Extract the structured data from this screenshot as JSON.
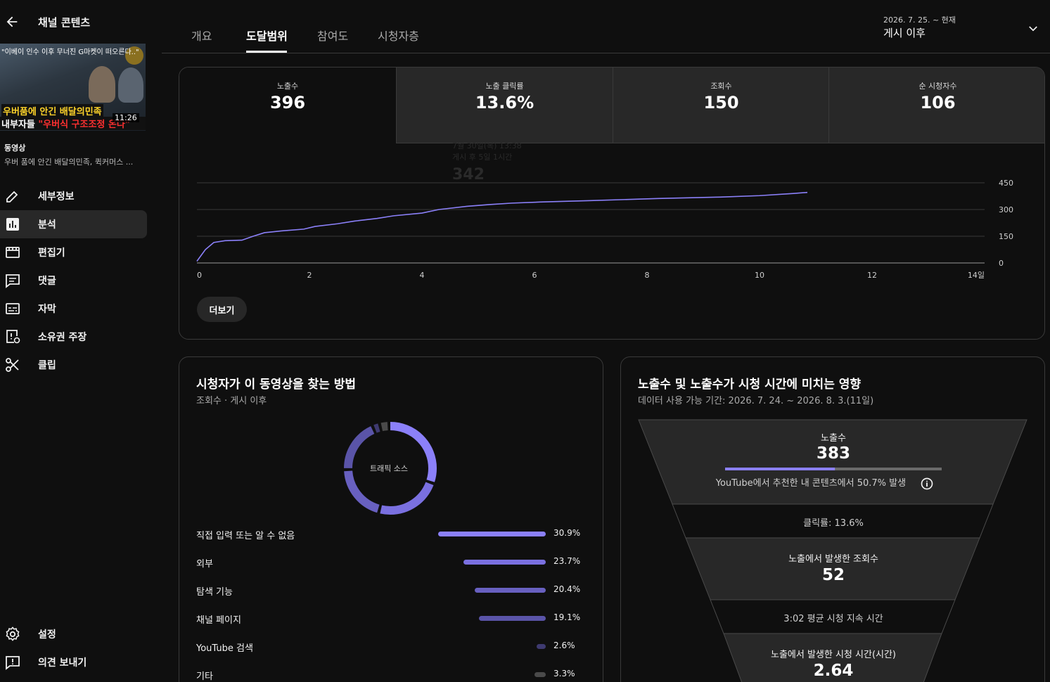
{
  "sidebar": {
    "title": "채널 콘텐츠",
    "thumbnail": {
      "top_caption": "\"이베이 인수 이후 무너진 G마켓이 떠오른다..\"",
      "banner_line1": "우버품에 안긴 배달의민족",
      "banner_line2_white": "내부자들",
      "banner_line2_red": "\"우버식 구조조정 온다\"",
      "duration": "11:26"
    },
    "video_label": "동영상",
    "video_title": "우버 품에 안긴 배달의민족, 퀵커머스 ...",
    "items": [
      {
        "label": "세부정보",
        "icon": "pencil-icon"
      },
      {
        "label": "분석",
        "icon": "analytics-icon"
      },
      {
        "label": "편집기",
        "icon": "editor-icon"
      },
      {
        "label": "댓글",
        "icon": "comment-icon"
      },
      {
        "label": "자막",
        "icon": "subtitles-icon"
      },
      {
        "label": "소유권 주장",
        "icon": "copyright-claim-icon"
      },
      {
        "label": "클립",
        "icon": "scissors-icon"
      }
    ],
    "bottom_items": [
      {
        "label": "설정",
        "icon": "gear-icon"
      },
      {
        "label": "의견 보내기",
        "icon": "feedback-icon"
      }
    ]
  },
  "tabs": [
    "개요",
    "도달범위",
    "참여도",
    "시청자층"
  ],
  "active_tab": "도달범위",
  "date_range": {
    "range": "2026. 7. 25. ~ 현재",
    "label": "게시 이후"
  },
  "kpis": [
    {
      "label": "노출수",
      "value": "396"
    },
    {
      "label": "노출 클릭률",
      "value": "13.6%"
    },
    {
      "label": "조회수",
      "value": "150"
    },
    {
      "label": "순 시청자수",
      "value": "106"
    }
  ],
  "ghost_tooltip": {
    "line1": "7월 30일(목) 13:38",
    "line2": "게시 후 5일 1시간",
    "value": "342"
  },
  "chart_data": {
    "type": "line",
    "title": "",
    "xlabel": "",
    "ylabel": "",
    "x_ticks": [
      "0",
      "2",
      "4",
      "6",
      "8",
      "10",
      "12",
      "14일"
    ],
    "y_ticks": [
      "0",
      "150",
      "300",
      "450"
    ],
    "xlim": [
      0,
      14
    ],
    "ylim": [
      0,
      450
    ],
    "series": [
      {
        "color": "#8b80f9",
        "x": [
          0,
          0.15,
          0.3,
          0.5,
          0.8,
          1.0,
          1.2,
          1.5,
          1.9,
          2.1,
          2.5,
          2.8,
          3.2,
          3.5,
          4.0,
          4.3,
          4.8,
          5.2,
          5.6,
          6.1,
          7.0,
          8.2,
          9.3,
          10.0,
          10.6,
          10.85
        ],
        "y": [
          10,
          75,
          115,
          125,
          128,
          150,
          170,
          180,
          190,
          205,
          220,
          235,
          250,
          265,
          280,
          300,
          318,
          328,
          336,
          342,
          350,
          362,
          370,
          378,
          390,
          396
        ]
      }
    ]
  },
  "more_button": "더보기",
  "traffic": {
    "title": "시청자가 이 동영상을 찾는 방법",
    "subtitle": "조회수 · 게시 이후",
    "donut_label": "트래픽 소스",
    "sources": [
      {
        "label": "직접 입력 또는 알 수 없음",
        "pct": "30.9%",
        "value": 30.9,
        "color": "#8b80f9"
      },
      {
        "label": "외부",
        "pct": "23.7%",
        "value": 23.7,
        "color": "#7a70e0"
      },
      {
        "label": "탐색 기능",
        "pct": "20.4%",
        "value": 20.4,
        "color": "#6860c0"
      },
      {
        "label": "채널 페이지",
        "pct": "19.1%",
        "value": 19.1,
        "color": "#5a54a8"
      },
      {
        "label": "YouTube 검색",
        "pct": "2.6%",
        "value": 2.6,
        "color": "#3e3a70"
      },
      {
        "label": "기타",
        "pct": "3.3%",
        "value": 3.3,
        "color": "#4a4a4a"
      }
    ]
  },
  "funnel": {
    "title": "노출수 및 노출수가 시청 시간에 미치는 영향",
    "subtitle": "데이터 사용 가능 기간: 2026. 7. 24. ~ 2026. 8. 3.(11일)",
    "impressions_label": "노출수",
    "impressions_value": "383",
    "recommended_fraction": 0.507,
    "recommended_text": "YouTube에서 추천한 내 콘텐츠에서 50.7% 발생",
    "ctr_text": "클릭률: 13.6%",
    "views_label": "노출에서 발생한 조회수",
    "views_value": "52",
    "avg_text": "3:02 평균 시청 지속 시간",
    "watch_label": "노출에서 발생한 시청 시간(시간)",
    "watch_value": "2.64"
  }
}
